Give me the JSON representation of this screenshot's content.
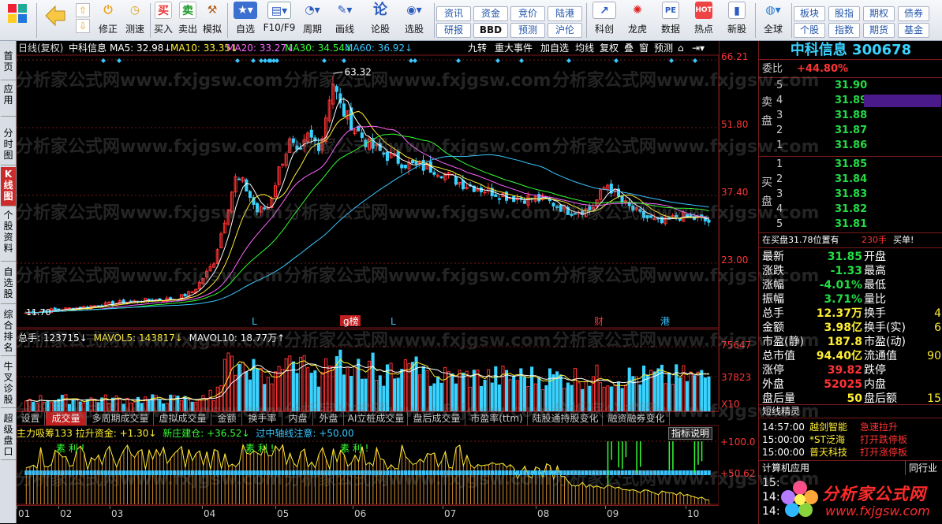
{
  "toolbar": {
    "groups": [
      {
        "label": "买入"
      },
      {
        "label": "卖出"
      },
      {
        "label": "模拟"
      },
      {
        "label": "自选"
      },
      {
        "label": "F10/F9"
      },
      {
        "label": "周期"
      },
      {
        "label": "画线"
      },
      {
        "label": "论股"
      },
      {
        "label": "选股"
      }
    ],
    "small_icons": [
      {
        "label": "修正"
      },
      {
        "label": "测速"
      }
    ],
    "buttons_top": [
      "资讯",
      "资金",
      "竞价",
      "陆港"
    ],
    "buttons_bottom": [
      "研报",
      "BBD",
      "预测",
      "沪伦"
    ],
    "icons2": [
      {
        "label": "科创"
      },
      {
        "label": "龙虎"
      },
      {
        "label": "数据"
      },
      {
        "label": "热点"
      },
      {
        "label": "新股"
      }
    ],
    "global_label": "全球",
    "buttons_right_top": [
      "板块",
      "股指",
      "期权",
      "债券"
    ],
    "buttons_right_bottom": [
      "个股",
      "指数",
      "期货",
      "基金"
    ]
  },
  "sidebar_tabs": [
    "首页",
    "应用",
    "分时图",
    "K线图",
    "个股资料",
    "自选股",
    "综合排名",
    "牛叉诊股",
    "超级盘口"
  ],
  "chart_header": {
    "period": "日线(复权)",
    "stock_name": "中科信息",
    "ma5": "MA5: 32.98↓",
    "ma10": "MA10: 33.35↓",
    "ma20": "MA20: 33.27↓",
    "ma30": "MA30: 34.54↓",
    "ma60": "MA60: 36.92↓",
    "right_buttons": [
      "九转",
      "重大事件",
      "加自选",
      "均线",
      "复权",
      "叠",
      "窗",
      "预测"
    ]
  },
  "price_axis": [
    "66.21",
    "51.80",
    "37.40",
    "23.00"
  ],
  "high_label": "63.32",
  "low_label": "11.70",
  "event_markers": [
    "L",
    "g榜",
    "L",
    "财",
    "港"
  ],
  "volume_header": {
    "total": "总手: 123715↓",
    "mavol5": "MAVOL5: 143817↓",
    "mavol10": "MAVOL10: 18.77万↑"
  },
  "volume_axis": [
    "75647",
    "37823",
    "X10"
  ],
  "indicator_tabs": [
    "设置",
    "成交量",
    "多周期成交量",
    "虚拟成交量",
    "金额",
    "换手率",
    "内盘",
    "外盘",
    "AI立桩成交量",
    "盘后成交量",
    "市盈率(ttm)",
    "陆股通持股变化",
    "融资融券变化"
  ],
  "indicator_header": {
    "name": "主力吸筹133 拉升资金: +1.30↓",
    "new": "新庄建仓: +36.52↓",
    "axis_label": "过中轴线注意: +50.00",
    "explain": "指标说明"
  },
  "indicator_axis": [
    "+100.0",
    "+50.62"
  ],
  "indicator_text": [
    "素 利 !",
    "素 利 !",
    "素 利 !"
  ],
  "month_axis": [
    "01",
    "02",
    "03",
    "04",
    "05",
    "06",
    "07",
    "08",
    "09",
    "10"
  ],
  "quote": {
    "title": "中科信息 300678",
    "weibi_label": "委比",
    "weibi_value": "+44.80%",
    "sell_label": "卖盘",
    "sell": [
      {
        "level": "5",
        "price": "31.90"
      },
      {
        "level": "4",
        "price": "31.89"
      },
      {
        "level": "3",
        "price": "31.88"
      },
      {
        "level": "2",
        "price": "31.87"
      },
      {
        "level": "1",
        "price": "31.86"
      }
    ],
    "buy_label": "买盘",
    "buy": [
      {
        "level": "1",
        "price": "31.85"
      },
      {
        "level": "2",
        "price": "31.84"
      },
      {
        "level": "3",
        "price": "31.83"
      },
      {
        "level": "4",
        "price": "31.82"
      },
      {
        "level": "5",
        "price": "31.81"
      }
    ],
    "note": "在买盘31.78位置有",
    "note_qty": "230手",
    "note_action": "买单!",
    "stats": [
      {
        "l": "最新",
        "v": "31.85",
        "l2": "开盘",
        "v2": ""
      },
      {
        "l": "涨跌",
        "v": "-1.33",
        "l2": "最高",
        "v2": ""
      },
      {
        "l": "涨幅",
        "v": "-4.01%",
        "l2": "最低",
        "v2": ""
      },
      {
        "l": "振幅",
        "v": "3.71%",
        "l2": "量比",
        "v2": ""
      },
      {
        "l": "总手",
        "v": "12.37万",
        "l2": "换手",
        "v2": "4"
      },
      {
        "l": "金额",
        "v": "3.98亿",
        "l2": "换手(实)",
        "v2": "6"
      },
      {
        "l": "市盈(静)",
        "v": "187.8",
        "l2": "市盈(动)",
        "v2": ""
      },
      {
        "l": "总市值",
        "v": "94.40亿",
        "l2": "流通值",
        "v2": "90"
      },
      {
        "l": "涨停",
        "v": "39.82",
        "l2": "跌停",
        "v2": ""
      },
      {
        "l": "外盘",
        "v": "52025",
        "l2": "内盘",
        "v2": ""
      },
      {
        "l": "盘后量",
        "v": "50",
        "l2": "盘后额",
        "v2": "15"
      }
    ],
    "jingling_title": "短线精灵",
    "jingling": [
      {
        "time": "14:57:00",
        "name": "越剑智能",
        "event": "急速拉升"
      },
      {
        "time": "15:00:00",
        "name": "*ST泛海",
        "event": "打开跌停板"
      },
      {
        "time": "15:00:00",
        "name": "普天科技",
        "event": "打开涨停板"
      }
    ],
    "bottom_tabs": [
      "计算机应用",
      "同行业"
    ],
    "bottom_rows": [
      "15:",
      "14:",
      "14:"
    ]
  },
  "watermark": "分析家公式网www.fxjgsw.com",
  "logo": {
    "title": "分析家公式网",
    "url": "www.fxjgsw.com"
  },
  "colors": {
    "up": "#ff3333",
    "down": "#39d3ff",
    "ma5": "#ffffff",
    "ma10": "#ffee33",
    "ma20": "#ff66ff",
    "ma30": "#33ff33",
    "ma60": "#39c6ff"
  }
}
